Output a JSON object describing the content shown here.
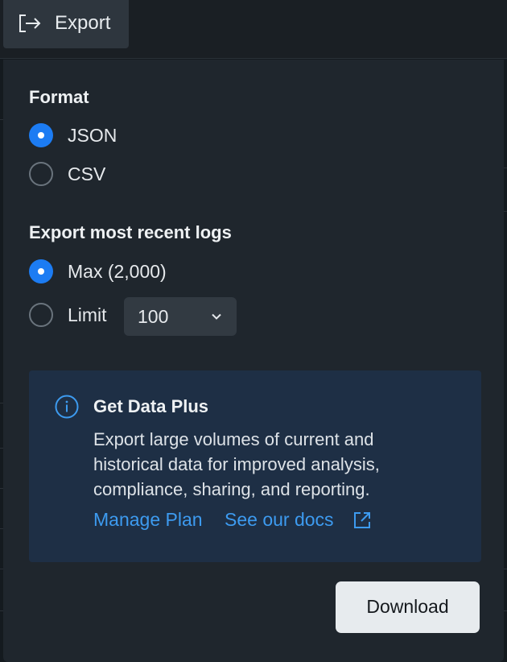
{
  "toolbar": {
    "export_label": "Export",
    "export_icon": "export-arrow-icon"
  },
  "panel": {
    "format": {
      "title": "Format",
      "options": [
        {
          "label": "JSON",
          "selected": true
        },
        {
          "label": "CSV",
          "selected": false
        }
      ]
    },
    "recent_logs": {
      "title": "Export most recent logs",
      "options": [
        {
          "label": "Max (2,000)",
          "selected": true
        },
        {
          "label": "Limit",
          "selected": false
        }
      ],
      "limit_select": {
        "value": "100",
        "icon": "chevron-down-icon"
      }
    },
    "promo": {
      "icon": "info-icon",
      "title": "Get Data Plus",
      "body": "Export large volumes of current and historical data for improved analysis, compliance, sharing, and reporting.",
      "manage_link": "Manage Plan",
      "docs_link": "See our docs",
      "docs_icon": "external-link-icon"
    },
    "download_label": "Download"
  },
  "colors": {
    "accent": "#1c7cf3",
    "link": "#3d9bf0",
    "panel_bg": "#1f262d",
    "card_bg": "#1e2f45"
  }
}
